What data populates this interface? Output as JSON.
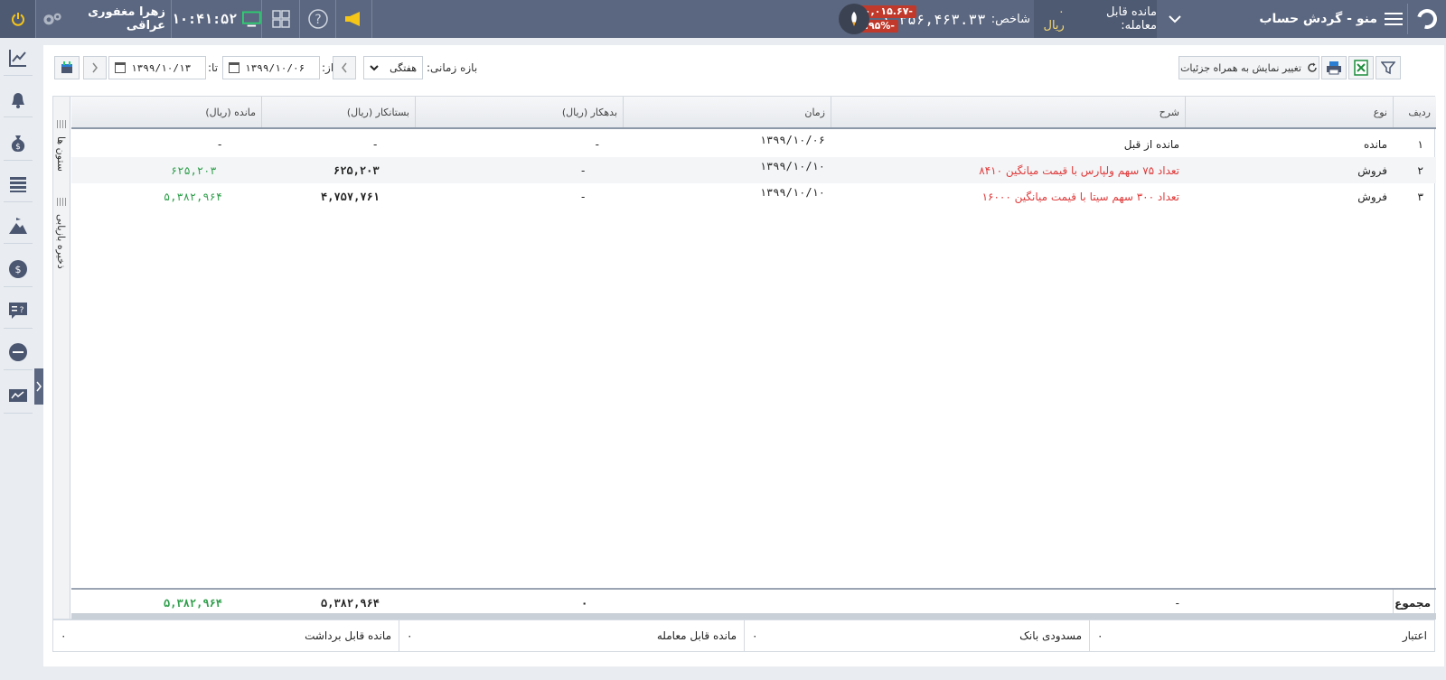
{
  "header": {
    "menu_title": "منو - گردش حساب",
    "balance_label": "مانده قابل معامله:",
    "balance_value": "۰ ریال",
    "index_label": "شاخص:",
    "index_value": "۱,۳۵۶,۴۶۳.۳۳",
    "index_change": "-۴۰,۰۱۵.۶۷",
    "index_percent": "-۲.۹۵%",
    "clock": "۱۰:۴۱:۵۲",
    "user_name": "زهرا مغفوری عراقی"
  },
  "toolbar": {
    "refresh_label": "تغییر نمایش به همراه جزئیات",
    "range_label": "بازه زمانی:",
    "range_value": "هفتگی",
    "from_label": "از:",
    "from_date": "۱۳۹۹/۱۰/۰۶",
    "to_label": "تا:",
    "to_date": "۱۳۹۹/۱۰/۱۳"
  },
  "grid": {
    "side_columns": "ستون ها",
    "side_save": "ذخیره بازیابی",
    "columns": [
      "ردیف",
      "نوع",
      "شرح",
      "زمان",
      "بدهکار (ریال)",
      "بستانکار (ریال)",
      "مانده (ریال)"
    ],
    "rows": [
      {
        "idx": "۱",
        "type": "مانده",
        "desc": "مانده از قبل",
        "time": "۱۳۹۹/۱۰/۰۶",
        "debit": "-",
        "credit": "-",
        "balance": "-"
      },
      {
        "idx": "۲",
        "type": "فروش",
        "desc": "تعداد ۷۵ سهم ولپارس با قیمت میانگین ۸۴۱۰",
        "time": "۱۳۹۹/۱۰/۱۰",
        "debit": "-",
        "credit": "۶۲۵,۲۰۳",
        "balance": "۶۲۵,۲۰۳"
      },
      {
        "idx": "۳",
        "type": "فروش",
        "desc": "تعداد ۳۰۰ سهم سیتا با قیمت میانگین ۱۶۰۰۰",
        "time": "۱۳۹۹/۱۰/۱۰",
        "debit": "-",
        "credit": "۴,۷۵۷,۷۶۱",
        "balance": "۵,۳۸۲,۹۶۴"
      }
    ],
    "footer": {
      "label": "مجموع",
      "desc": "-",
      "debit": "۰",
      "credit": "۵,۳۸۲,۹۶۴",
      "balance": "۵,۳۸۲,۹۶۴"
    }
  },
  "summary": [
    {
      "label": "اعتبار",
      "value": "۰"
    },
    {
      "label": "مسدودی بانک",
      "value": "۰"
    },
    {
      "label": "مانده قابل معامله",
      "value": "۰"
    },
    {
      "label": "مانده قابل برداشت",
      "value": "۰"
    }
  ],
  "colors": {
    "topbar": "#5b6780",
    "negative": "#e03b3b",
    "positive": "#2e9e4a",
    "badge": "#c0392b"
  }
}
